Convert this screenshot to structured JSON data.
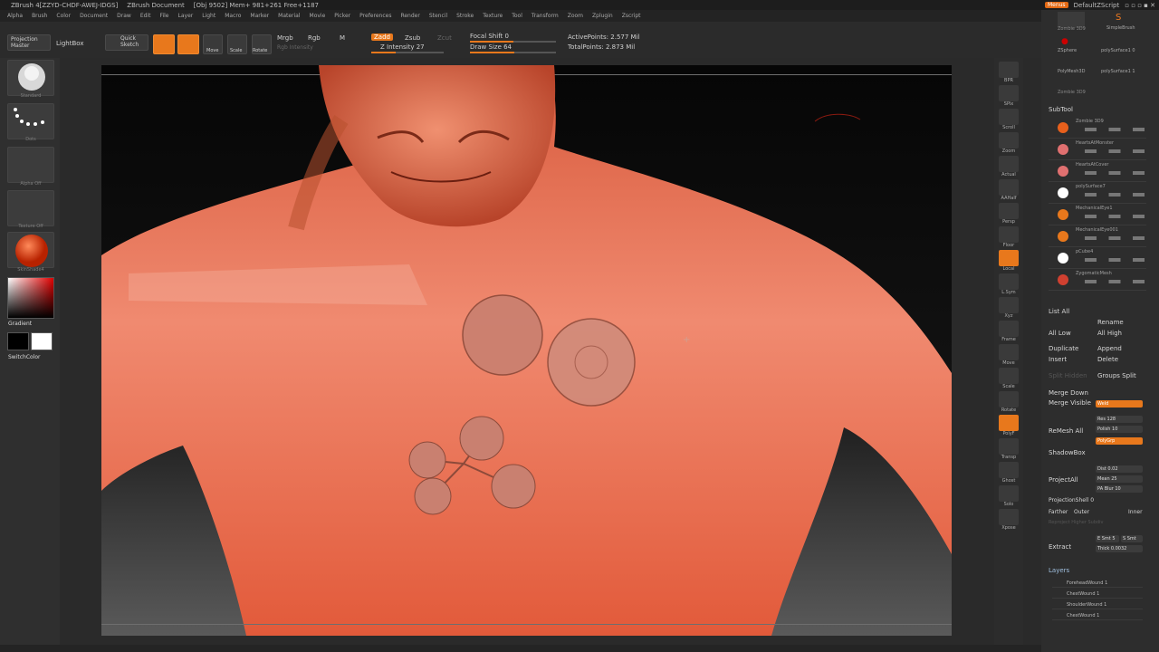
{
  "titlebar": {
    "app": "ZBrush 4[ZZYD-CHDF-AWEJ-IDGS]",
    "document": "ZBrush Document",
    "mem": "[Obj 9502] Mem+ 981+261 Free+1187",
    "menus_button": "Menus",
    "script": "DefaultZScript"
  },
  "menubar": [
    "Alpha",
    "Brush",
    "Color",
    "Document",
    "Draw",
    "Edit",
    "File",
    "Layer",
    "Light",
    "Macro",
    "Marker",
    "Material",
    "Movie",
    "Picker",
    "Preferences",
    "Render",
    "Stencil",
    "Stroke",
    "Texture",
    "Tool",
    "Transform",
    "Zoom",
    "Zplugin",
    "Zscript"
  ],
  "toolbar": {
    "projection_master": "Projection Master",
    "lightbox": "LightBox",
    "quick_sketch": "Quick Sketch",
    "edit": "Edit",
    "draw": "Draw",
    "move": "Move",
    "scale": "Scale",
    "rotate": "Rotate",
    "mrgb": "Mrgb",
    "rgb": "Rgb",
    "m": "M",
    "rgb_intensity": "Rgb Intensity",
    "zadd": "Zadd",
    "zsub": "Zsub",
    "zcut": "Zcut",
    "z_intensity": "Z Intensity 27",
    "focal_shift": "Focal Shift 0",
    "draw_size": "Draw Size 64",
    "active_points": "ActivePoints: 2.577 Mil",
    "total_points": "TotalPoints: 2.873 Mil"
  },
  "leftpanel": {
    "brush_label": "Standard",
    "stroke_label": "Dots",
    "alpha_label": "Alpha Off",
    "texture_label": "Texture Off",
    "material_label": "SkinShade4",
    "gradient": "Gradient",
    "switch_color": "SwitchColor"
  },
  "shelf": [
    "BPR",
    "SPix",
    "Scroll",
    "Zoom",
    "Actual",
    "AAHalf",
    "Persp",
    "Floor",
    "Local",
    "L.Sym",
    "Xyz",
    "Frame",
    "Move",
    "Scale",
    "Rotate",
    "PolyF",
    "Transp",
    "Ghost",
    "Solo",
    "Xpose"
  ],
  "rightpanel": {
    "tool_top_left": "Zombie 3D9",
    "tool_top_right": "SimpleBrush",
    "tools": [
      "ZSphere",
      "polySurface1 0",
      "PolyMesh3D",
      "polySurface1 1",
      "Zombie 3D9"
    ],
    "subtool_header": "SubTool",
    "subtools": [
      "Zombie 3D9",
      "HeartsAtMonster",
      "HeartsAtCover",
      "polySurface7",
      "MechanicalEye1",
      "MechanicalEye001",
      "pCube4",
      "ZygomaticMesh"
    ],
    "list_all": "List All",
    "rename": "Rename",
    "all_low": "All Low",
    "all_high": "All High",
    "duplicate": "Duplicate",
    "append": "Append",
    "insert": "Insert",
    "delete": "Delete",
    "split_hidden": "Split Hidden",
    "groups_split": "Groups Split",
    "merge_down": "Merge Down",
    "merge_visible": "Merge Visible",
    "weld": "Weld",
    "remesh_all": "ReMesh All",
    "res": "Res 128",
    "polish": "Polish 10",
    "polygroups": "PolyGrp",
    "shadowbox": "ShadowBox",
    "project_all": "ProjectAll",
    "dist": "Dist 0.02",
    "mean": "Mean 25",
    "pa_blur": "PA Blur 10",
    "projection_shell": "ProjectionShell 0",
    "farther": "Farther",
    "outer": "Outer",
    "inner": "Inner",
    "reproject_higher": "Reproject Higher Subdiv",
    "extract": "Extract",
    "e_smt": "E Smt 5",
    "s_smt": "S Smt",
    "thick": "Thick 0.0032",
    "layers_header": "Layers",
    "layers": [
      "ForeheadWound 1",
      "ChestWound 1",
      "ShoulderWound 1",
      "ChestWound 1"
    ]
  },
  "colors": {
    "accent": "#e8781c",
    "skin": "#e0654a",
    "background": "#2a2a2a"
  }
}
